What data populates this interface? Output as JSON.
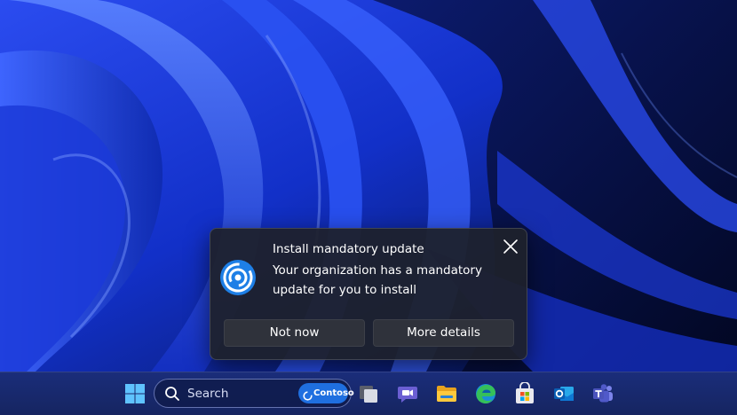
{
  "toast": {
    "title": "Install mandatory update",
    "body": "Your organization has a mandatory update for you to install",
    "buttons": {
      "not_now": "Not now",
      "more_details": "More details"
    },
    "icons": {
      "app": "update-ring-icon",
      "close": "close-icon"
    }
  },
  "taskbar": {
    "search": {
      "placeholder": "Search",
      "brand_badge": "Contoso"
    },
    "icons": [
      "windows-start-icon",
      "search-icon",
      "task-view-icon",
      "teams-chat-icon",
      "file-explorer-icon",
      "edge-browser-icon",
      "microsoft-store-icon",
      "outlook-icon",
      "teams-icon"
    ]
  },
  "colors": {
    "accent_blue": "#1f6fe0",
    "wallpaper_blue": "#1d3fe0",
    "toast_background": "#1e212c",
    "taskbar_background": "#1a2d7a"
  }
}
